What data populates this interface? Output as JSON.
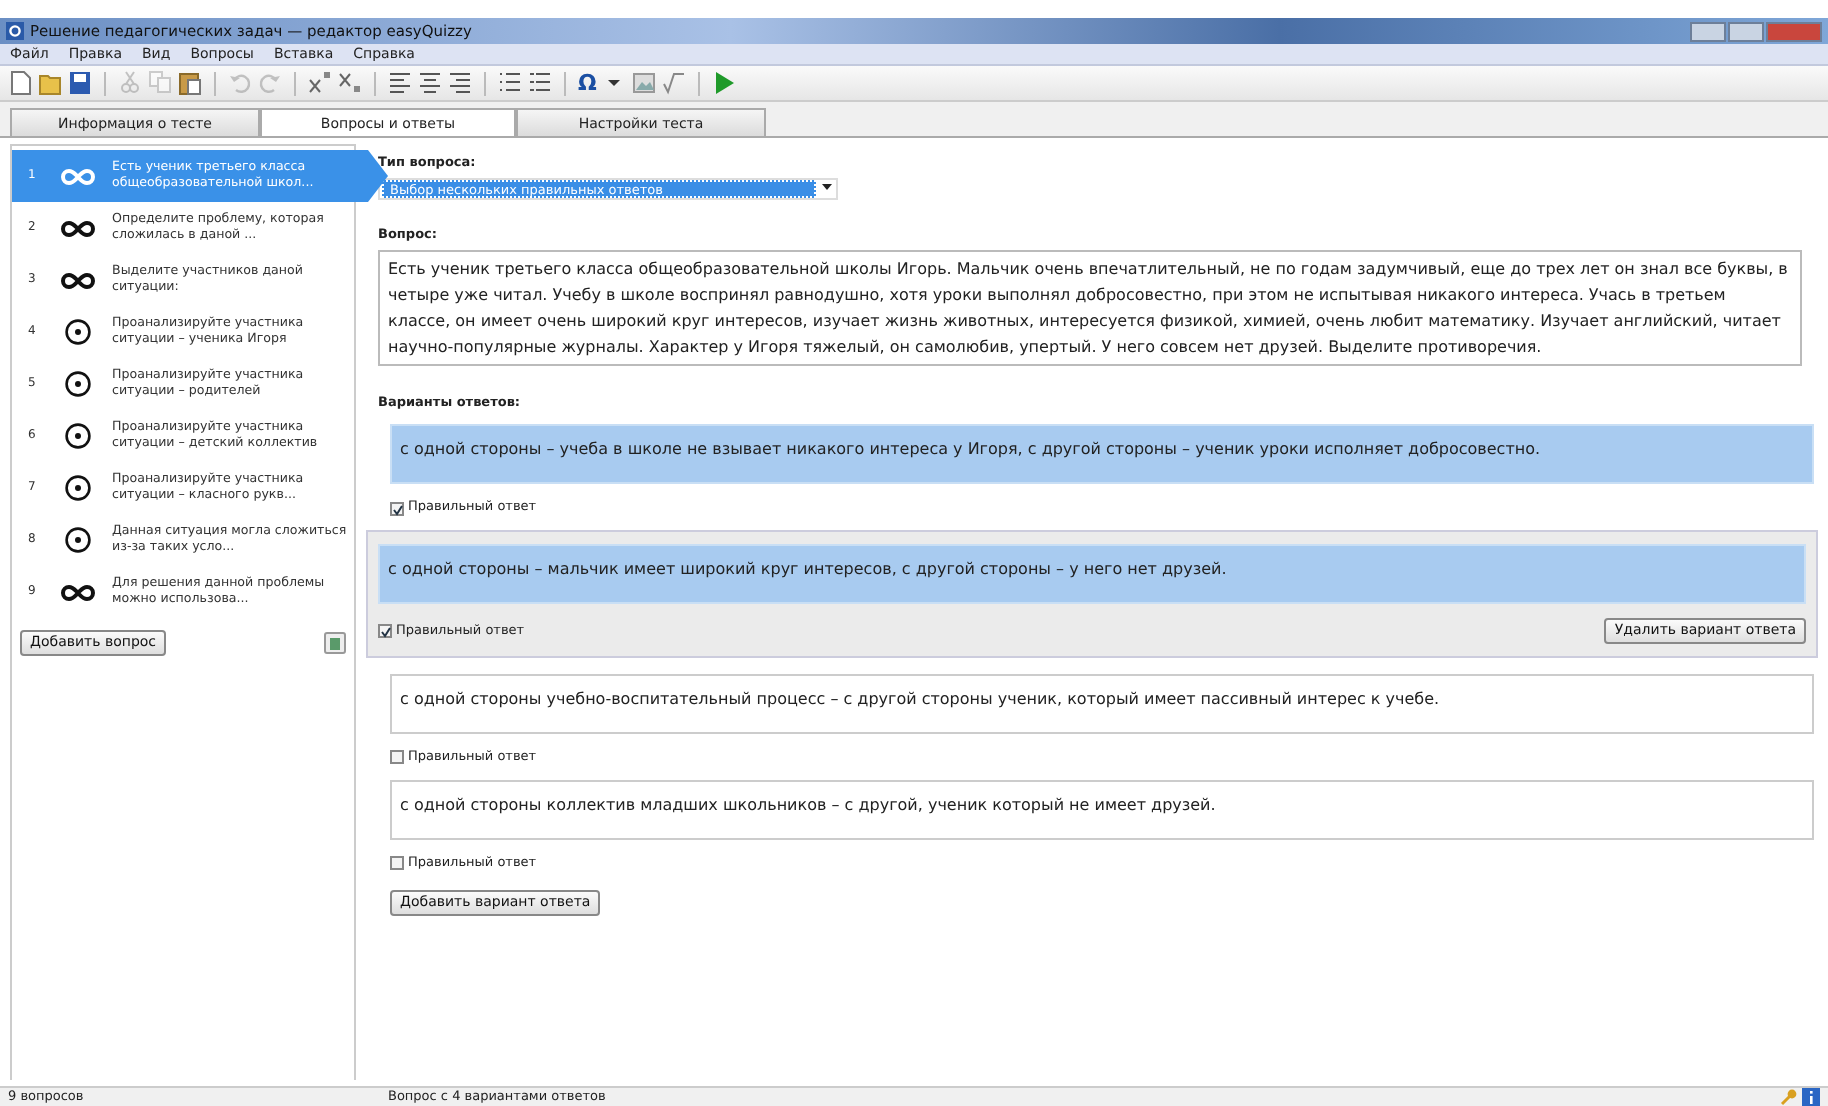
{
  "window": {
    "title": "Решение педагогических задач — редактор easyQuizzy"
  },
  "menu": [
    "Файл",
    "Правка",
    "Вид",
    "Вопросы",
    "Вставка",
    "Справка"
  ],
  "toolbar": [
    {
      "kind": "new"
    },
    {
      "kind": "open"
    },
    {
      "kind": "save"
    },
    {
      "kind": "sep"
    },
    {
      "kind": "cut",
      "disabled": true
    },
    {
      "kind": "copy",
      "disabled": true
    },
    {
      "kind": "paste",
      "disabled": false
    },
    {
      "kind": "sep"
    },
    {
      "kind": "undo",
      "disabled": true
    },
    {
      "kind": "redo",
      "disabled": true
    },
    {
      "kind": "sep"
    },
    {
      "kind": "superscript"
    },
    {
      "kind": "subscript"
    },
    {
      "kind": "sep"
    },
    {
      "kind": "align-left"
    },
    {
      "kind": "align-center"
    },
    {
      "kind": "align-right"
    },
    {
      "kind": "sep"
    },
    {
      "kind": "numbered-list"
    },
    {
      "kind": "bullet-list"
    },
    {
      "kind": "sep"
    },
    {
      "kind": "text",
      "label": "Ω"
    },
    {
      "kind": "caret"
    },
    {
      "kind": "image"
    },
    {
      "kind": "formula"
    },
    {
      "kind": "sep"
    },
    {
      "kind": "play"
    }
  ],
  "tabs": [
    {
      "label": "Информация о тесте",
      "selected": false
    },
    {
      "label": "Вопросы и ответы",
      "selected": true
    },
    {
      "label": "Настройки теста",
      "selected": false
    }
  ],
  "questions": [
    {
      "number": "1",
      "kind": "multiple",
      "text": "Есть ученик третьего класса общеобразовательной школ...",
      "selected": true
    },
    {
      "number": "2",
      "kind": "multiple",
      "text": "Определите проблему, которая сложилась в даной ...",
      "selected": false
    },
    {
      "number": "3",
      "kind": "multiple",
      "text": "Выделите участников даной ситуации:",
      "selected": false
    },
    {
      "number": "4",
      "kind": "single",
      "text": "Проанализируйте участника ситуации – ученика Игоря",
      "selected": false
    },
    {
      "number": "5",
      "kind": "single",
      "text": "Проанализируйте участника ситуации – родителей",
      "selected": false
    },
    {
      "number": "6",
      "kind": "single",
      "text": "Проанализируйте участника ситуации – детский коллектив",
      "selected": false
    },
    {
      "number": "7",
      "kind": "single",
      "text": "Проанализируйте участника ситуации – класного рукв...",
      "selected": false
    },
    {
      "number": "8",
      "kind": "single",
      "text": "Данная ситуация могла сложиться из-за таких усло...",
      "selected": false
    },
    {
      "number": "9",
      "kind": "multiple",
      "text": "Для решения данной проблемы можно использова...",
      "selected": false
    }
  ],
  "add_question_button": "Добавить вопрос",
  "question_type": {
    "label": "Тип вопроса:",
    "value": "Выбор нескольких правильных ответов"
  },
  "question": {
    "label": "Вопрос:",
    "text": "Есть ученик третьего класса общеобразовательной школы Игорь. Мальчик очень впечатлительный, не по годам задумчивый, еще до трех лет он знал все буквы, в четыре уже читал. Учебу в школе воспринял равнодушно, хотя уроки выполнял добросовестно, при этом не испытывая никакого интереса. Учась в третьем классе, он имеет очень широкий круг интересов, изучает жизнь животных, интересуется физикой, химией, очень любит математику. Изучает английский, читает научно-популярные журналы. Характер у Игоря тяжелый, он самолюбив, упертый. У него совсем нет друзей. Выделите противоречия."
  },
  "answers_label": "Варианты ответов:",
  "answers": [
    {
      "text": "с одной стороны – учеба в школе не взывает никакого интереса у Игоря, с другой стороны – ученик уроки исполняет добросовестно.",
      "correct": true,
      "correct_label": "Правильный ответ",
      "selected": false
    },
    {
      "text": "с одной стороны – мальчик имеет широкий круг интересов, с другой стороны – у него нет друзей.",
      "correct": true,
      "correct_label": "Правильный ответ",
      "selected": true,
      "delete_button": "Удалить вариант ответа"
    },
    {
      "text": "с одной стороны учебно-воспитательный процесс – с другой стороны ученик, который имеет пассивный интерес к учебе.",
      "correct": false,
      "correct_label": "Правильный ответ",
      "selected": false
    },
    {
      "text": "с одной стороны коллектив младших школьников – с другой, ученик который не имеет друзей.",
      "correct": false,
      "correct_label": "Правильный ответ",
      "selected": false
    }
  ],
  "add_answer_button": "Добавить вариант ответа",
  "status_bar": [
    "9 вопросов",
    "Вопрос с 4 вариантами ответов"
  ]
}
